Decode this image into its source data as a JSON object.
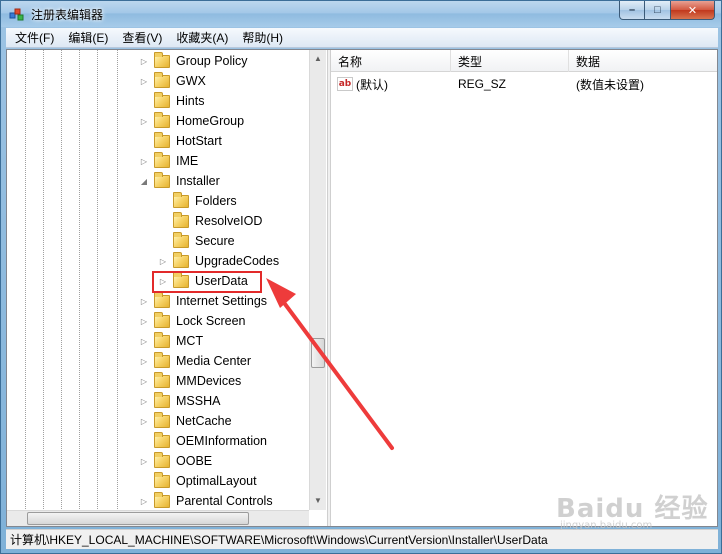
{
  "window": {
    "title": "注册表编辑器",
    "caption_min": "–",
    "caption_max": "□",
    "caption_close": "✕"
  },
  "menu": [
    "文件(F)",
    "编辑(E)",
    "查看(V)",
    "收藏夹(A)",
    "帮助(H)"
  ],
  "tree": [
    {
      "label": "Group Policy",
      "level": 0,
      "expander": "collapsed"
    },
    {
      "label": "GWX",
      "level": 0,
      "expander": "collapsed"
    },
    {
      "label": "Hints",
      "level": 0,
      "expander": "none"
    },
    {
      "label": "HomeGroup",
      "level": 0,
      "expander": "collapsed"
    },
    {
      "label": "HotStart",
      "level": 0,
      "expander": "none"
    },
    {
      "label": "IME",
      "level": 0,
      "expander": "collapsed"
    },
    {
      "label": "Installer",
      "level": 0,
      "expander": "expanded"
    },
    {
      "label": "Folders",
      "level": 1,
      "expander": "none"
    },
    {
      "label": "ResolveIOD",
      "level": 1,
      "expander": "none"
    },
    {
      "label": "Secure",
      "level": 1,
      "expander": "none"
    },
    {
      "label": "UpgradeCodes",
      "level": 1,
      "expander": "collapsed"
    },
    {
      "label": "UserData",
      "level": 1,
      "expander": "collapsed",
      "selected": true
    },
    {
      "label": "Internet Settings",
      "level": 0,
      "expander": "collapsed"
    },
    {
      "label": "Lock Screen",
      "level": 0,
      "expander": "collapsed"
    },
    {
      "label": "MCT",
      "level": 0,
      "expander": "collapsed"
    },
    {
      "label": "Media Center",
      "level": 0,
      "expander": "collapsed"
    },
    {
      "label": "MMDevices",
      "level": 0,
      "expander": "collapsed"
    },
    {
      "label": "MSSHA",
      "level": 0,
      "expander": "collapsed"
    },
    {
      "label": "NetCache",
      "level": 0,
      "expander": "collapsed"
    },
    {
      "label": "OEMInformation",
      "level": 0,
      "expander": "none"
    },
    {
      "label": "OOBE",
      "level": 0,
      "expander": "collapsed"
    },
    {
      "label": "OptimalLayout",
      "level": 0,
      "expander": "none"
    },
    {
      "label": "Parental Controls",
      "level": 0,
      "expander": "collapsed"
    }
  ],
  "list": {
    "columns": [
      "名称",
      "类型",
      "数据"
    ],
    "rows": [
      {
        "icon": "ab",
        "name": "(默认)",
        "type": "REG_SZ",
        "data": "(数值未设置)"
      }
    ]
  },
  "status": {
    "path": "计算机\\HKEY_LOCAL_MACHINE\\SOFTWARE\\Microsoft\\Windows\\CurrentVersion\\Installer\\UserData"
  },
  "watermark": {
    "main": "Baidu 经验",
    "sub": "jingyan.baidu.com"
  },
  "colors": {
    "annotation_red": "#e22a2a",
    "folder_yellow": "#f7d46a"
  }
}
